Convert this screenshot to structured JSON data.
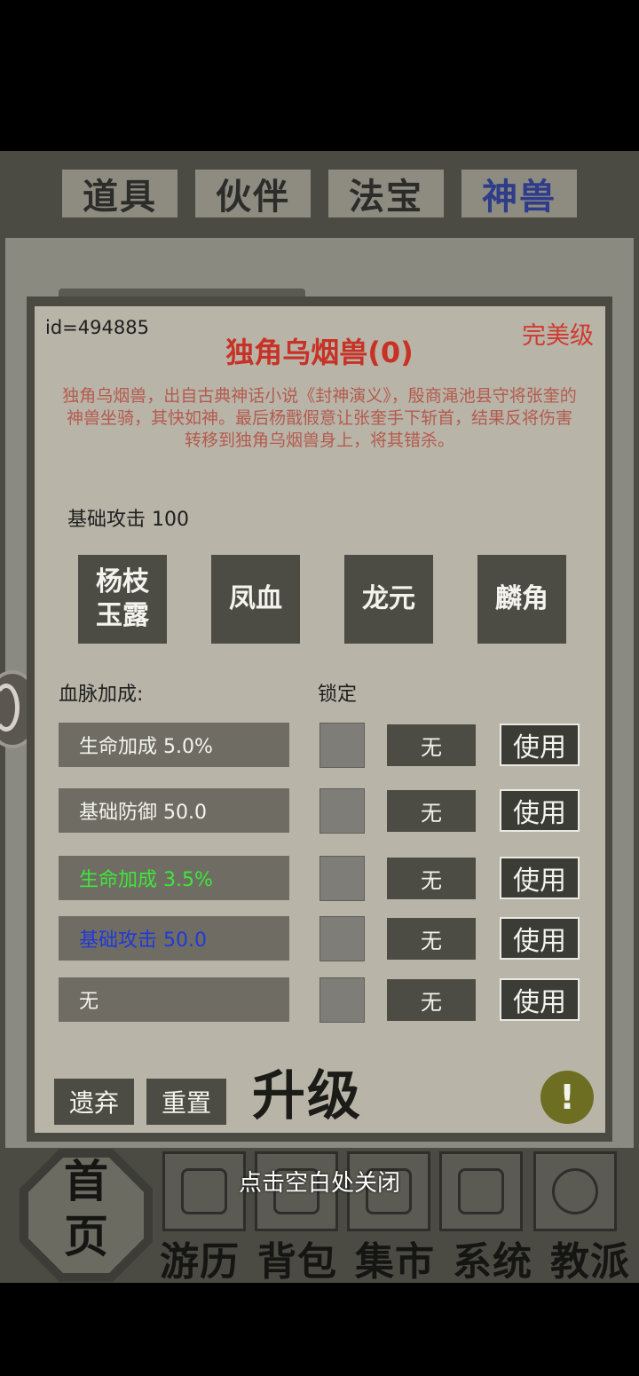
{
  "tabs": [
    {
      "label": "道具",
      "active": false
    },
    {
      "label": "伙伴",
      "active": false
    },
    {
      "label": "法宝",
      "active": false
    },
    {
      "label": "神兽",
      "active": true
    }
  ],
  "pet": {
    "id_text": "id=494885",
    "grade": "完美级",
    "name": "独角乌烟兽(0)",
    "description": "独角乌烟兽，出自古典神话小说《封神演义》，殷商渑池县守将张奎的神兽坐骑，其快如神。最后杨戬假意让张奎手下斩首，结果反将伤害转移到独角乌烟兽身上，将其错杀。",
    "base_attack": "基础攻击 100"
  },
  "skills": [
    "杨枝玉露",
    "凤血",
    "龙元",
    "麟角"
  ],
  "bloodline": {
    "label": "血脉加成:",
    "lock_label": "锁定",
    "rows": [
      {
        "attr": "生命加成 5.0%",
        "color": "#f4f4ee",
        "slot": "无",
        "use": "使用"
      },
      {
        "attr": "基础防御 50.0",
        "color": "#f4f4ee",
        "slot": "无",
        "use": "使用"
      },
      {
        "attr": "生命加成 3.5%",
        "color": "#3ee63a",
        "slot": "无",
        "use": "使用"
      },
      {
        "attr": "基础攻击 50.0",
        "color": "#2038d8",
        "slot": "无",
        "use": "使用"
      },
      {
        "attr": "无",
        "color": "#f4f4ee",
        "slot": "无",
        "use": "使用"
      }
    ]
  },
  "actions": {
    "discard": "遗弃",
    "reset": "重置",
    "upgrade": "升级",
    "warning_icon": "!"
  },
  "close_hint": "点击空白处关闭",
  "nav": {
    "home": "首页",
    "items": [
      "游历",
      "背包",
      "集市",
      "系统",
      "教派"
    ]
  }
}
